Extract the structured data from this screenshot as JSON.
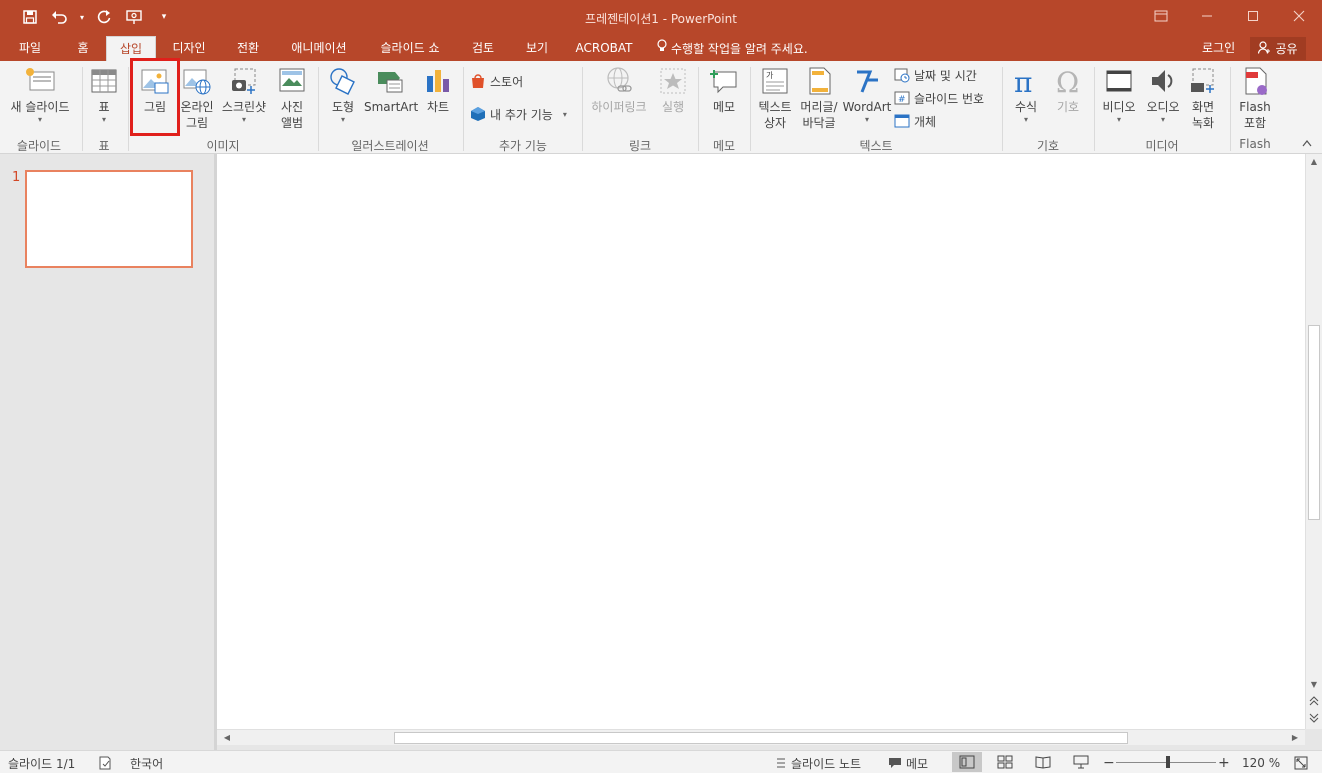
{
  "window": {
    "title": "프레젠테이션1 - PowerPoint"
  },
  "qat": {
    "save_icon": "save-icon",
    "undo_icon": "undo-icon",
    "redo_icon": "redo-icon",
    "present_icon": "present-from-start-icon",
    "customize_icon": "customize-qat-icon"
  },
  "tabs": [
    {
      "label": "파일"
    },
    {
      "label": "홈"
    },
    {
      "label": "삽입"
    },
    {
      "label": "디자인"
    },
    {
      "label": "전환"
    },
    {
      "label": "애니메이션"
    },
    {
      "label": "슬라이드 쇼"
    },
    {
      "label": "검토"
    },
    {
      "label": "보기"
    },
    {
      "label": "ACROBAT"
    }
  ],
  "tell_me": "수행할 작업을 알려 주세요.",
  "account": {
    "login": "로그인",
    "share": "공유"
  },
  "ribbon": {
    "new_slide_line1": "새 슬라이드",
    "table": "표",
    "picture": "그림",
    "online_picture_line1": "온라인",
    "online_picture_line2": "그림",
    "screenshot": "스크린샷",
    "photo_album_line1": "사진",
    "photo_album_line2": "앨범",
    "shapes": "도형",
    "smartart": "SmartArt",
    "chart": "차트",
    "store": "스토어",
    "my_addins": "내 추가 기능",
    "hyperlink": "하이퍼링크",
    "action": "실행",
    "comment": "메모",
    "textbox_line1": "텍스트",
    "textbox_line2": "상자",
    "header_footer_line1": "머리글/",
    "header_footer_line2": "바닥글",
    "wordart": "WordArt",
    "date_time": "날짜 및 시간",
    "slide_number": "슬라이드 번호",
    "object": "개체",
    "equation": "수식",
    "symbol": "기호",
    "video": "비디오",
    "audio": "오디오",
    "screen_recording_line1": "화면",
    "screen_recording_line2": "녹화",
    "flash_line1": "Flash",
    "flash_line2": "포함"
  },
  "groups": {
    "slides": "슬라이드",
    "tables": "표",
    "images": "이미지",
    "illustrations": "일러스트레이션",
    "addins": "추가 기능",
    "links": "링크",
    "comments": "메모",
    "text": "텍스트",
    "symbols": "기호",
    "media": "미디어",
    "flash": "Flash"
  },
  "thumbnails": [
    {
      "number": "1"
    }
  ],
  "status": {
    "slide_info": "슬라이드 1/1",
    "language": "한국어",
    "notes": "슬라이드 노트",
    "comments": "메모",
    "zoom": "120 %"
  },
  "colors": {
    "accent": "#b7472a",
    "highlight_box": "#e0201b",
    "thumb_border": "#e9825f"
  }
}
